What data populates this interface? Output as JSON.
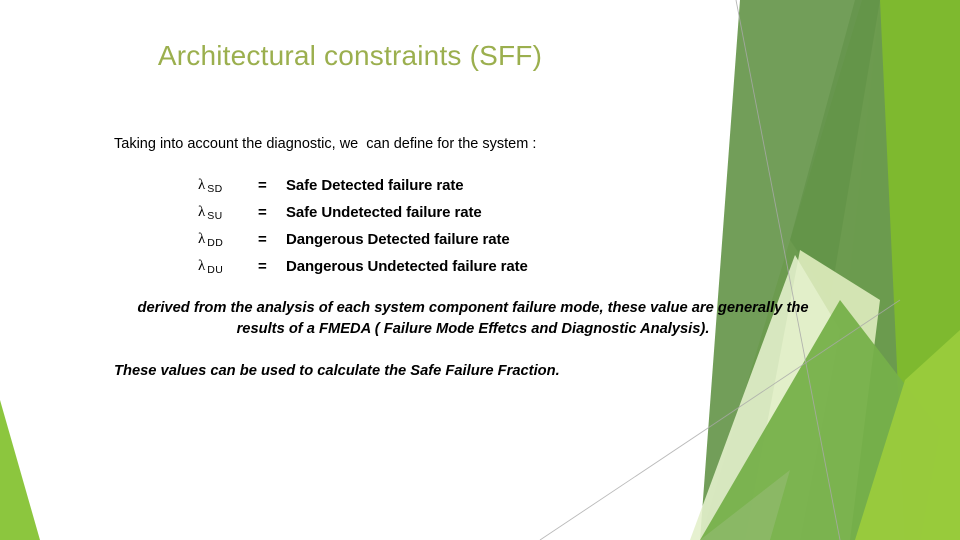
{
  "slide": {
    "title": "Architectural constraints (SFF)",
    "title_color": "#9BAF4E",
    "background_color": "#FFFFFF",
    "intro": "Taking into account the diagnostic, we  can define for the system :",
    "definitions": [
      {
        "symbol": "λ",
        "subscript": "SD",
        "equals": "=",
        "description": "Safe Detected failure rate"
      },
      {
        "symbol": "λ",
        "subscript": "SU",
        "equals": "=",
        "description": "Safe Undetected failure rate"
      },
      {
        "symbol": "λ",
        "subscript": "DD",
        "equals": "=",
        "description": "Dangerous Detected failure rate"
      },
      {
        "symbol": "λ",
        "subscript": "DU",
        "equals": "=",
        "description": "Dangerous Undetected failure rate"
      }
    ],
    "note": {
      "line1": "derived from the analysis of each system component failure mode, these value are",
      "line2_before": "generally the results of a ",
      "line2_emphasis": "FMEDA",
      "line2_after": " ( Failure Mode Effetcs and Diagnostic Analysis)."
    },
    "closing": "These values can be used to calculate the Safe Failure Fraction.",
    "decoration": {
      "name": "green-angled-shapes",
      "colors": {
        "bright_green": "#7DB82E",
        "yellow_green": "#8CC63E",
        "olive_green": "#6A9950",
        "mid_green": "#76B04A",
        "pale_green": "#DCEABC",
        "light_green": "#C3DE8E",
        "line_gray": "#A9A9A9"
      }
    }
  }
}
